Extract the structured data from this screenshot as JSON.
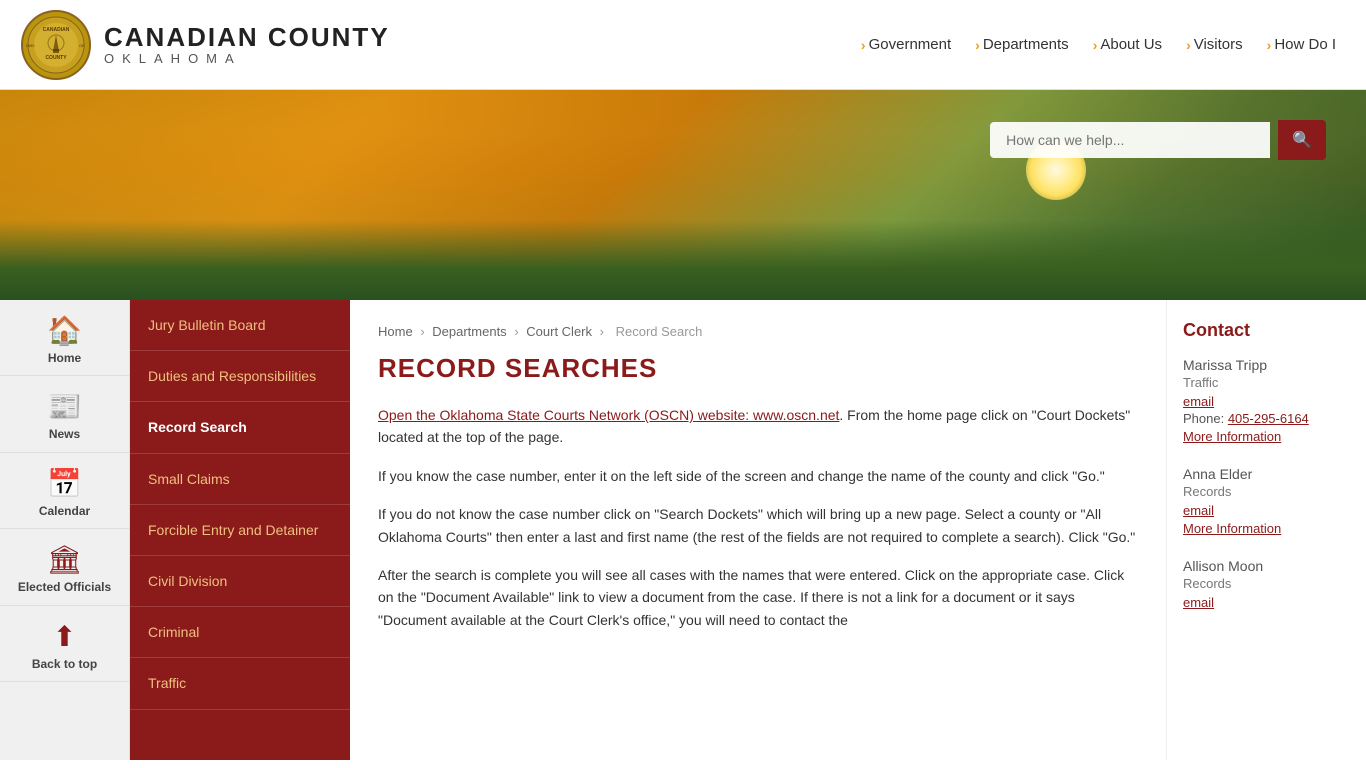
{
  "header": {
    "logo_title": "CANADIAN COUNTY",
    "logo_subtitle": "OKLAHOMA",
    "nav_items": [
      {
        "label": "Government",
        "id": "government"
      },
      {
        "label": "Departments",
        "id": "departments"
      },
      {
        "label": "About Us",
        "id": "about-us"
      },
      {
        "label": "Visitors",
        "id": "visitors"
      },
      {
        "label": "How Do I",
        "id": "how-do-i"
      }
    ]
  },
  "search": {
    "placeholder": "How can we help...",
    "button_icon": "🔍"
  },
  "icon_nav": [
    {
      "id": "home",
      "icon": "🏠",
      "label": "Home"
    },
    {
      "id": "news",
      "icon": "📰",
      "label": "News"
    },
    {
      "id": "calendar",
      "icon": "📅",
      "label": "Calendar"
    },
    {
      "id": "elected-officials",
      "icon": "🏛",
      "label": "Elected Officials"
    },
    {
      "id": "back-to-top",
      "icon": "⬆",
      "label": "Back to top"
    }
  ],
  "side_menu": [
    {
      "label": "Jury Bulletin Board",
      "id": "jury-bulletin-board"
    },
    {
      "label": "Duties and Responsibilities",
      "id": "duties-responsibilities"
    },
    {
      "label": "Record Search",
      "id": "record-search",
      "active": true
    },
    {
      "label": "Small Claims",
      "id": "small-claims"
    },
    {
      "label": "Forcible Entry and Detainer",
      "id": "forcible-entry"
    },
    {
      "label": "Civil Division",
      "id": "civil-division"
    },
    {
      "label": "Criminal",
      "id": "criminal"
    },
    {
      "label": "Traffic",
      "id": "traffic"
    }
  ],
  "breadcrumb": {
    "items": [
      "Home",
      "Departments",
      "Court Clerk",
      "Record Search"
    ],
    "separators": [
      "›",
      "›",
      "›"
    ]
  },
  "page": {
    "title": "RECORD SEARCHES",
    "paragraphs": [
      {
        "id": "p1",
        "link_text": "Open the Oklahoma State Courts Network (OSCN) website",
        "link_url": "www.oscn.net",
        "rest": ". From the home page click on \"Court Dockets\" located at the top of the page."
      },
      {
        "id": "p2",
        "text": "If you know the case number, enter it on the left side of the screen and change the name of the county and click \"Go.\""
      },
      {
        "id": "p3",
        "text": "If you do not know the case number click on \"Search Dockets\" which will bring up a new page. Select a county or \"All Oklahoma Courts\" then enter a last and first name (the rest of the fields are not required to complete a search). Click \"Go.\""
      },
      {
        "id": "p4",
        "text": "After the search is complete you will see all cases with the names that were entered. Click on the appropriate case. Click on the \"Document Available\" link to view a document from the case. If there is not a link for a document or it says \"Document available at the Court Clerk's office,\" you will need to contact the"
      }
    ]
  },
  "contact": {
    "title": "Contact",
    "people": [
      {
        "name": "Marissa Tripp",
        "role": "Traffic",
        "email_label": "email",
        "phone_label": "Phone:",
        "phone": "405-295-6164",
        "more_label": "More Information"
      },
      {
        "name": "Anna Elder",
        "role": "Records",
        "email_label": "email",
        "more_label": "More Information"
      },
      {
        "name": "Allison Moon",
        "role": "Records",
        "email_label": "email"
      }
    ]
  }
}
